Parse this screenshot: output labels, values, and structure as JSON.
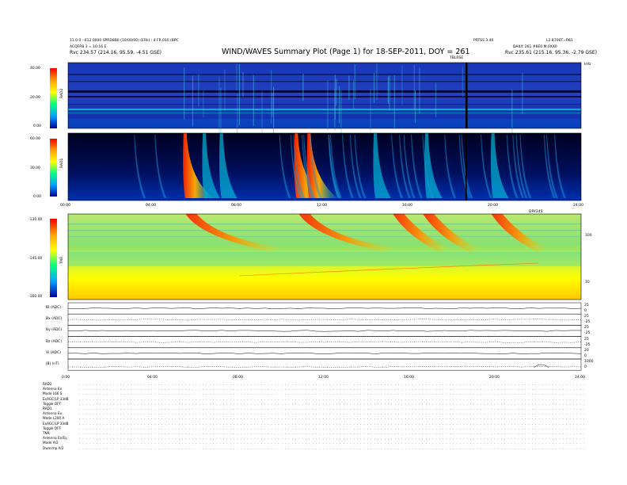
{
  "header": {
    "meta_line1": "11.0.0 - 612.0000 SPRD8B0 (10/00/00) (ERk) : 4 FR.010 (BPC",
    "meta_line2": "ACQFR8 3 = 10:16 E",
    "pos_left": "Rvc   234.57 (214.16, 95.59, -4.51 GSE)",
    "code_center": "PRTSS 3.40",
    "code_right": "L3 B700T=R61",
    "daily_line": "DAILY: 261 #8E0 M.0XX0",
    "pos_right": "Rvc   235.61 (215.16, 95.36, -2.79 GSE)",
    "title": "WIND/WAVES Summary Plot (Page 1) for 18-SEP-2011, DOY = 261",
    "marker_label": "TBLRSE",
    "khz_label": "kHz"
  },
  "panels": {
    "rad2": {
      "label": "RAD2",
      "ticks": [
        "40.00",
        "20.00",
        "0.00"
      ]
    },
    "rad1": {
      "label": "RAD1",
      "ticks": [
        "60.00",
        "30.00",
        "0.00"
      ]
    },
    "tnr": {
      "label": "TNR",
      "ticks": [
        "-130.00",
        "-145.00",
        "-160.00"
      ],
      "right_ticks": [
        "100",
        "10"
      ],
      "corner_label": "DRY24S"
    }
  },
  "time_axis_labels": [
    "00:00",
    "04:00",
    "08:00",
    "12:00",
    "16:00",
    "20:00",
    "24:00"
  ],
  "line_panels": [
    "BI (ADC)",
    "Bx (ADC)",
    "By (ADC)",
    "Bz (ADC)",
    "Vi (ADC)",
    "|B| (nT)"
  ],
  "line_panels_right": [
    "25",
    "0",
    "25",
    "-25",
    "25",
    "-25",
    "25",
    "-25",
    "20",
    "0",
    "1000",
    "0"
  ],
  "bottom_axis_labels": [
    "0:00",
    "04:00",
    "08:00",
    "12:00",
    "16:00",
    "20:00",
    "24:00"
  ],
  "footer": {
    "block1": [
      "RAD2",
      "Antenna    Ex",
      "Mode     L66 S",
      "ExAGC/LP   33dB",
      "Toggle     OFF"
    ],
    "block2": [
      "RAD1",
      "Antenna    Ex",
      "Mode   L200 A",
      "ExAGC/LP  33dB",
      "Toggle     OFF"
    ],
    "block3": [
      "TNR",
      "Antenna   Ex/Ey",
      "Mode      A/2",
      "Dwnsmp    A/2"
    ]
  },
  "chart_data": {
    "type": "heatmap",
    "title": "WIND/WAVES Summary Plot (Page 1) for 18-SEP-2011, DOY = 261",
    "xlabel": "",
    "x_range": [
      "00:00",
      "24:00"
    ],
    "panels": [
      {
        "name": "RAD2",
        "y_ticks": [
          0,
          20,
          40
        ]
      },
      {
        "name": "RAD1",
        "y_ticks": [
          0,
          30,
          60
        ]
      },
      {
        "name": "TNR",
        "y_ticks": [
          -160,
          -145,
          -130
        ],
        "right_axis": "kHz",
        "right_ticks": [
          10,
          100
        ]
      }
    ],
    "burst_times_hours": [
      5.4,
      6.3,
      7.1,
      10.6,
      11.2,
      14.3,
      16.7,
      19.8
    ],
    "colors": {
      "low": "#00008b",
      "mid": "#00c8c8",
      "high": "#ff2000",
      "background": "#000040"
    }
  }
}
